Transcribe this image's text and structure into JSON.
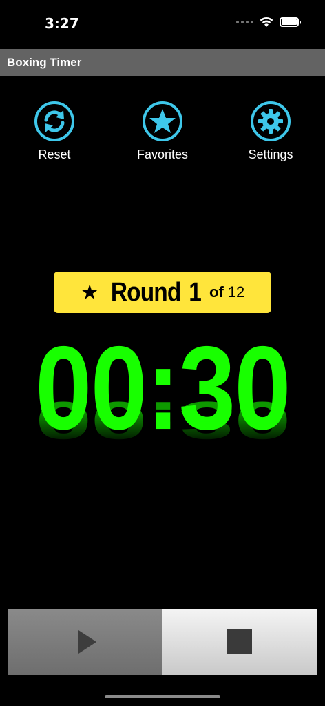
{
  "status_bar": {
    "time": "3:27"
  },
  "title_bar": {
    "title": "Boxing Timer"
  },
  "toolbar": {
    "reset_label": "Reset",
    "favorites_label": "Favorites",
    "settings_label": "Settings",
    "icon_color": "#3ec7ea"
  },
  "round": {
    "star": "★",
    "word": "Round",
    "current": "1",
    "of": "of",
    "total": "12",
    "badge_color": "#ffe53b"
  },
  "timer": {
    "display": "00:30",
    "color": "#18ff00"
  },
  "controls": {
    "play_icon": "play-icon",
    "stop_icon": "stop-icon"
  }
}
